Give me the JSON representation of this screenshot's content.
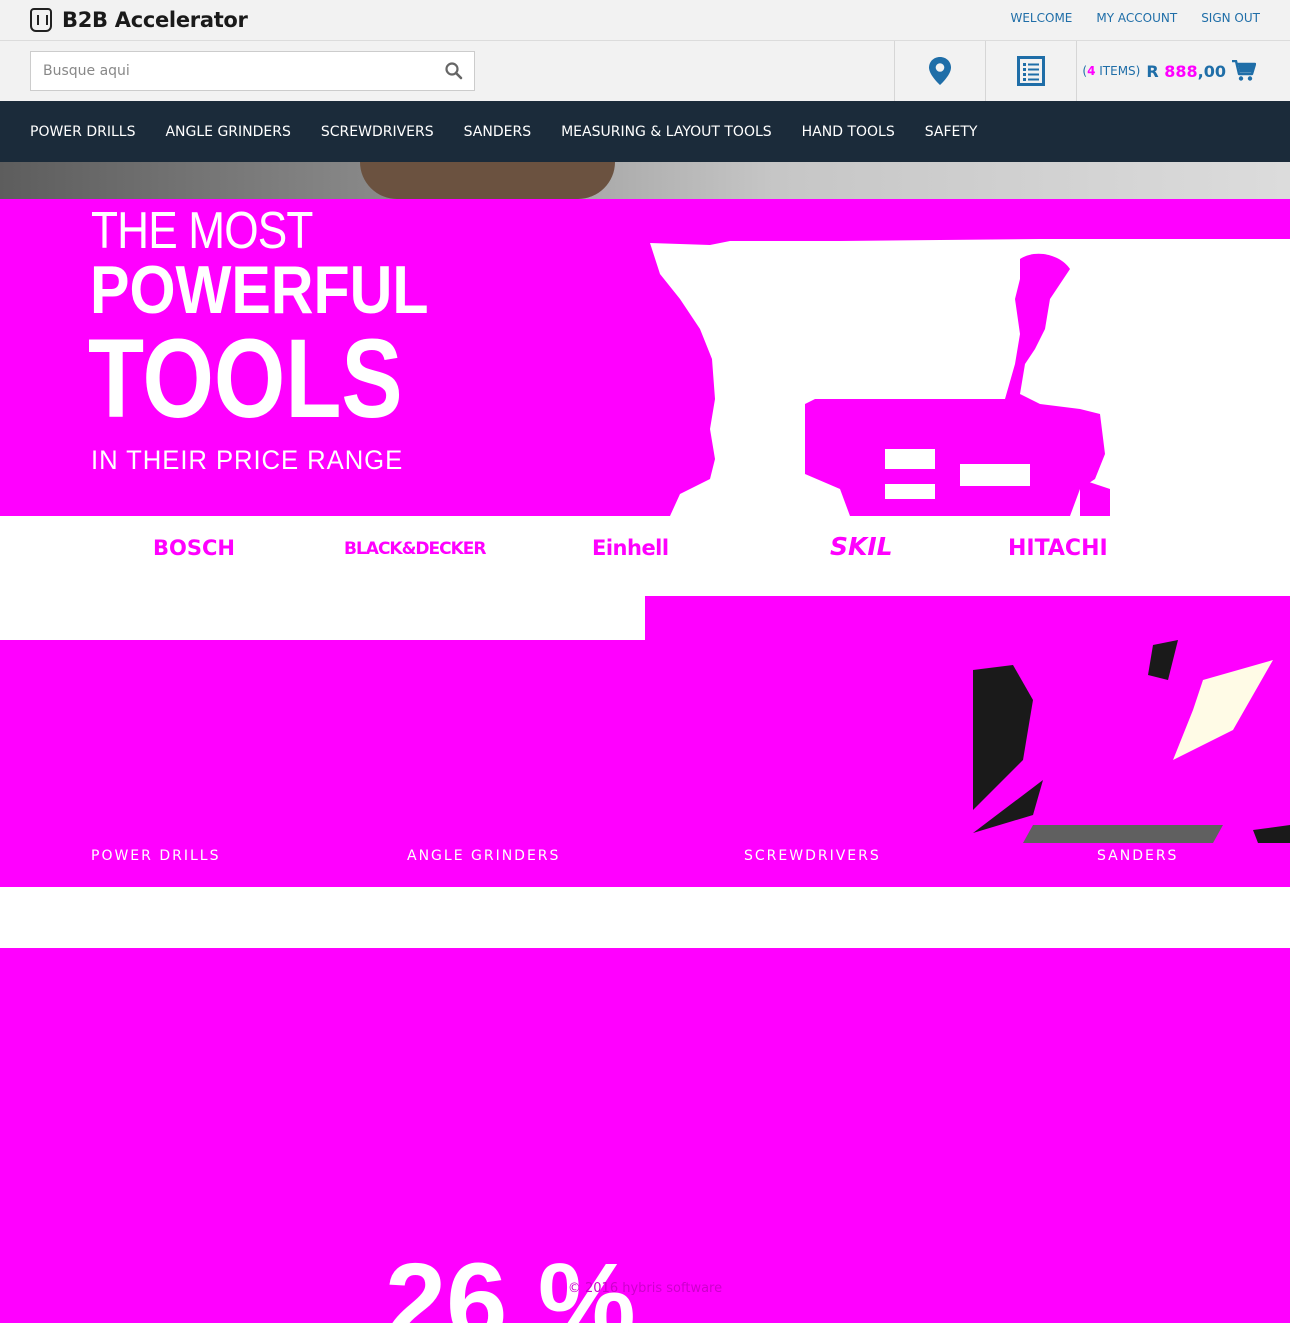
{
  "brand": {
    "logo_text": "B2B Accelerator"
  },
  "top_links": [
    "WELCOME",
    "MY ACCOUNT",
    "SIGN OUT"
  ],
  "search": {
    "placeholder": "Busque aqui"
  },
  "cart": {
    "count_open": "(",
    "count": "4",
    "count_label": " ITEMS)",
    "total_prefix": "R ",
    "total_masked": "888",
    "total_suffix": ",00"
  },
  "nav": [
    "POWER DRILLS",
    "ANGLE GRINDERS",
    "SCREWDRIVERS",
    "SANDERS",
    "MEASURING & LAYOUT TOOLS",
    "HAND TOOLS",
    "SAFETY"
  ],
  "hero": {
    "line1": "THE MOST",
    "line2": "POWERFUL",
    "line3": "TOOLS",
    "line4": "IN THEIR PRICE RANGE"
  },
  "brands": [
    "BOSCH",
    "BLACK&DECKER",
    "Einhell",
    "SKIL",
    "HITACHI"
  ],
  "categories": [
    "POWER DRILLS",
    "ANGLE GRINDERS",
    "SCREWDRIVERS",
    "SANDERS"
  ],
  "footer": {
    "copyright": "© 2016 hybris software",
    "big_text": "26 %"
  },
  "colors": {
    "nav_bg": "#1b2b3a",
    "link": "#1f6ea8",
    "placeholder_fill": "#ff00ff"
  },
  "icons": [
    "logo-icon",
    "search-icon",
    "map-pin-icon",
    "order-form-icon",
    "cart-icon"
  ]
}
